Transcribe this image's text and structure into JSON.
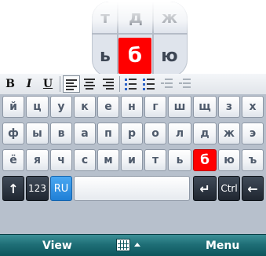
{
  "magnifier": {
    "cells": [
      "т",
      "д",
      "ж",
      "ь",
      "б",
      "ю"
    ],
    "highlight": "б"
  },
  "toolbar": {
    "bold": "B",
    "italic": "I",
    "underline": "U"
  },
  "keyboard": {
    "row1": [
      "й",
      "ц",
      "у",
      "к",
      "е",
      "н",
      "г",
      "ш",
      "щ",
      "з",
      "х"
    ],
    "row2": [
      "ф",
      "ы",
      "в",
      "а",
      "п",
      "р",
      "о",
      "л",
      "д",
      "ж",
      "э"
    ],
    "row3": [
      "ё",
      "я",
      "ч",
      "с",
      "м",
      "и",
      "т",
      "ь",
      "б",
      "ю",
      "ъ"
    ],
    "highlighted_key": "б",
    "fn": {
      "shift": "↑",
      "num": "123",
      "lang": "RU",
      "enter": "↵",
      "ctrl": "Ctrl",
      "backspace": "←"
    }
  },
  "softkeys": {
    "left": "View",
    "right": "Menu"
  },
  "colors": {
    "highlight": "#ff0000",
    "lang_key": "#1f7fd6",
    "softbar": "#1f6f77"
  }
}
